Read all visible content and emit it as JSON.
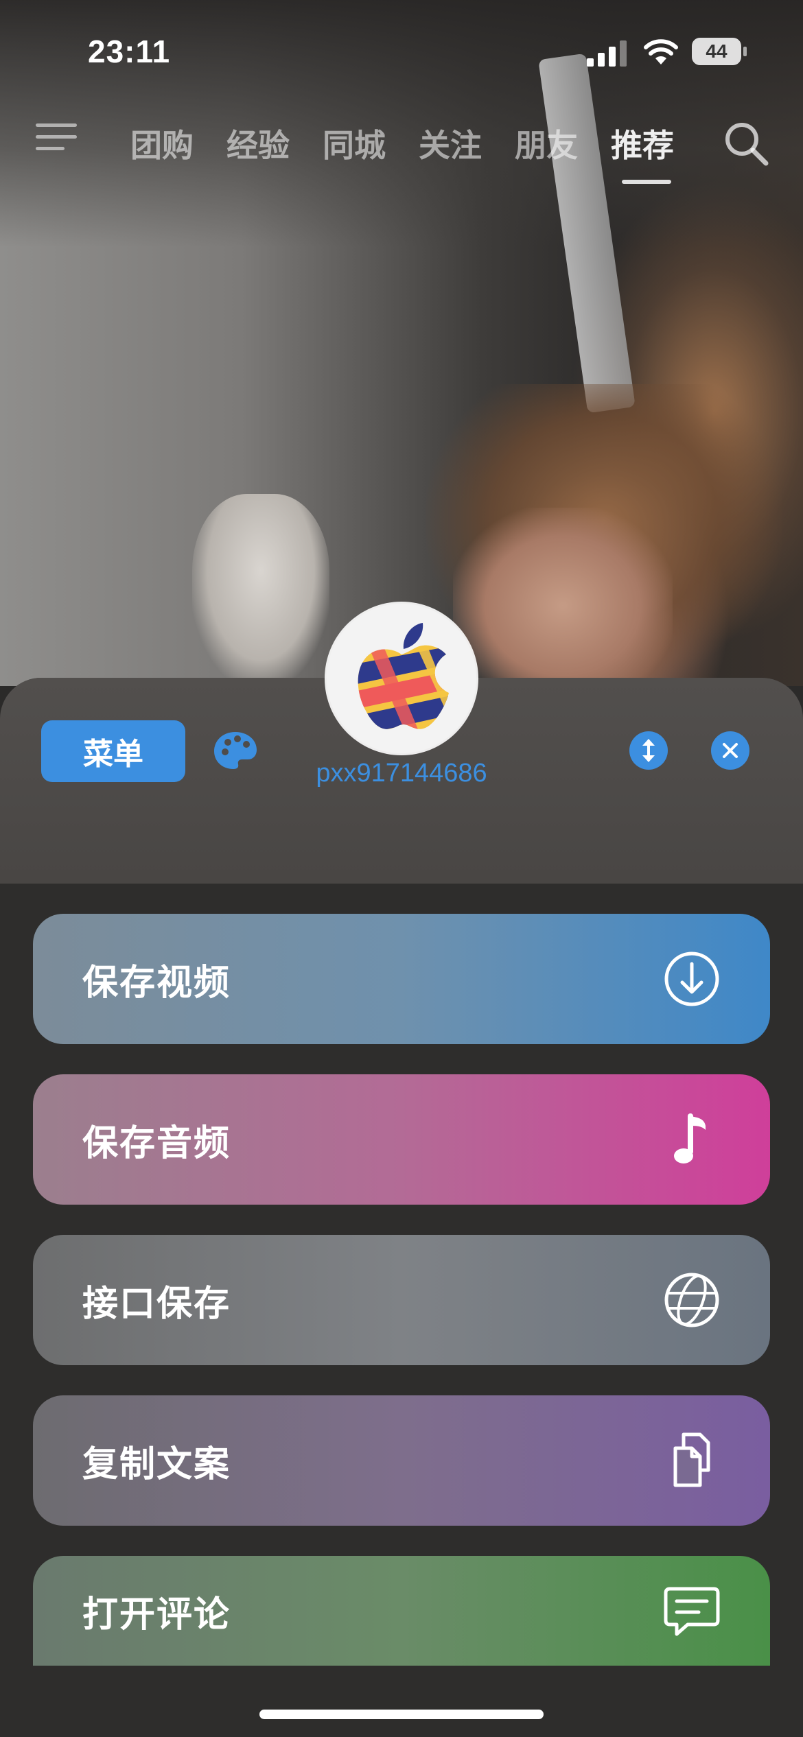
{
  "status_bar": {
    "time": "23:11",
    "battery": "44"
  },
  "top_nav": {
    "tabs": [
      {
        "label": "团购"
      },
      {
        "label": "经验"
      },
      {
        "label": "同城"
      },
      {
        "label": "关注"
      },
      {
        "label": "朋友"
      },
      {
        "label": "推荐",
        "active": true
      }
    ]
  },
  "sheet": {
    "menu_label": "菜单",
    "username": "pxx917144686",
    "accent_color": "#3c8fe0",
    "actions": [
      {
        "label": "保存视频",
        "icon": "download-circle-icon"
      },
      {
        "label": "保存音频",
        "icon": "music-note-icon"
      },
      {
        "label": "接口保存",
        "icon": "globe-icon"
      },
      {
        "label": "复制文案",
        "icon": "copy-documents-icon"
      },
      {
        "label": "打开评论",
        "icon": "chat-bubble-icon"
      }
    ]
  }
}
